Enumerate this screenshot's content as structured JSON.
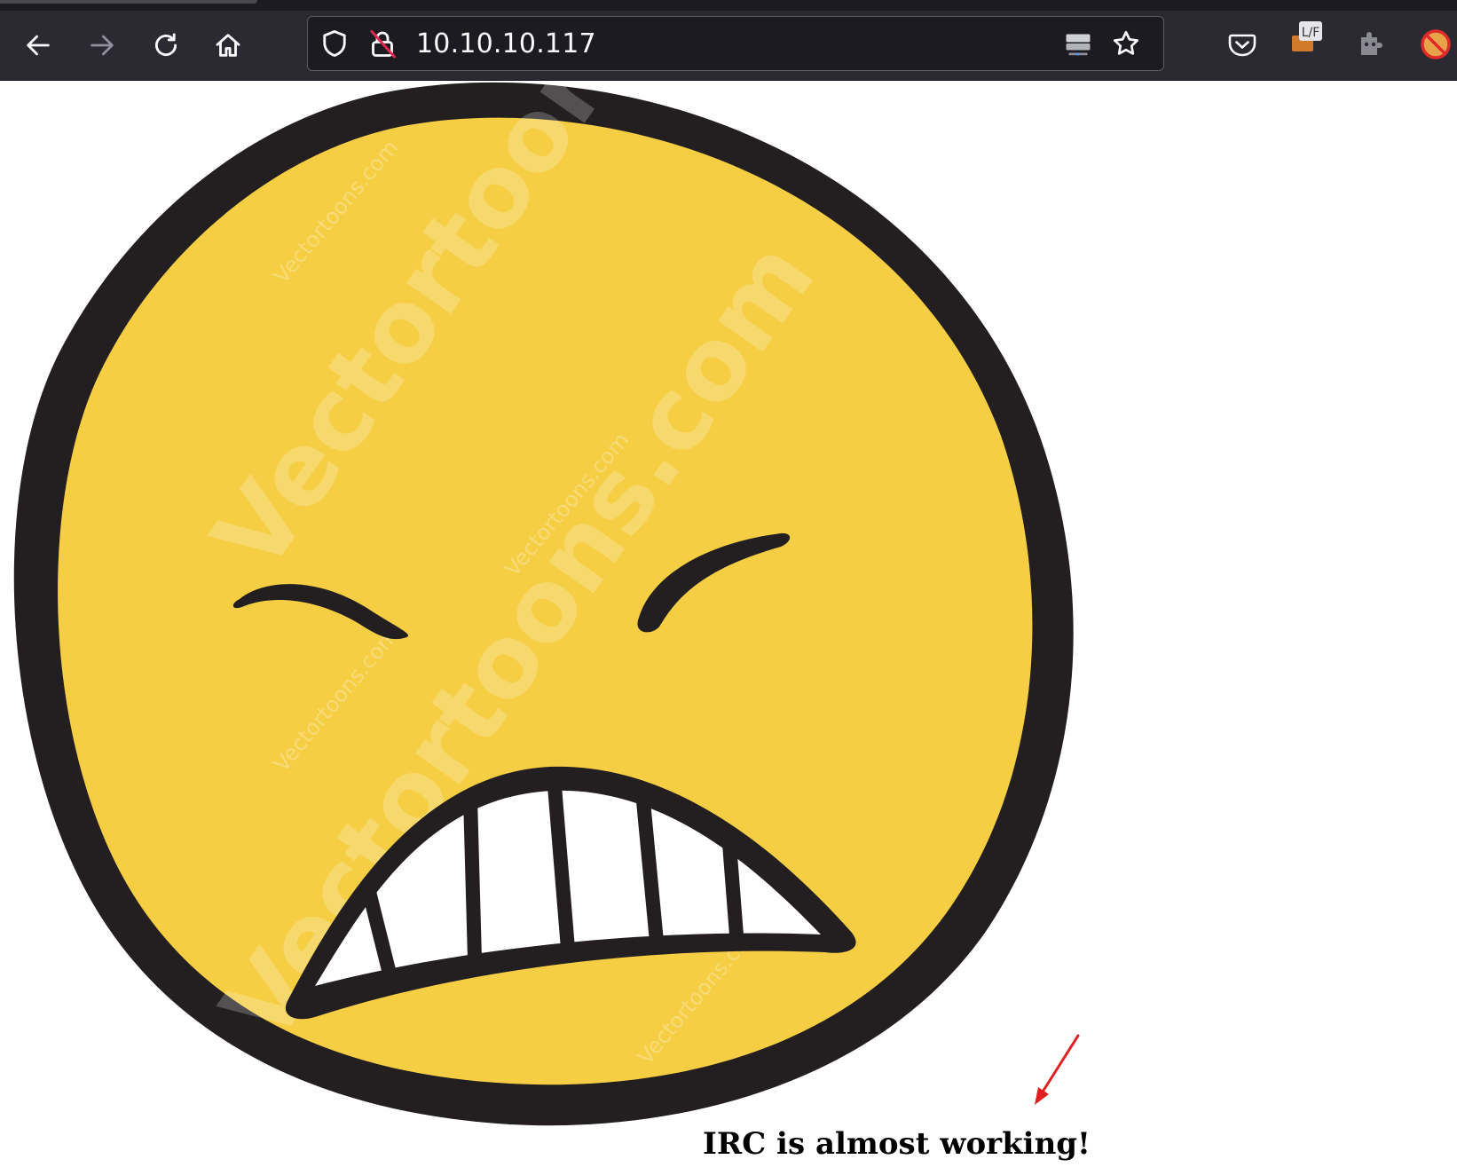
{
  "browser": {
    "address_bar": {
      "url": "10.10.10.117",
      "security_state": "not-secure"
    },
    "nav_buttons": [
      "back",
      "forward",
      "reload",
      "home"
    ],
    "extensions": [
      "pocket-icon",
      "lf-extension-icon",
      "puzzle-extension-icon",
      "blocked-extension-icon"
    ],
    "extension_badge_text": "L/F"
  },
  "page": {
    "heading": "IRC is almost working!",
    "image": {
      "subject": "grimacing-emoji",
      "watermark": "Vectortoons.com",
      "colors": {
        "face": "#f5ce44",
        "outline": "#231f20",
        "teeth": "#ffffff"
      }
    },
    "annotation": {
      "type": "arrow",
      "color": "#e02020"
    }
  }
}
